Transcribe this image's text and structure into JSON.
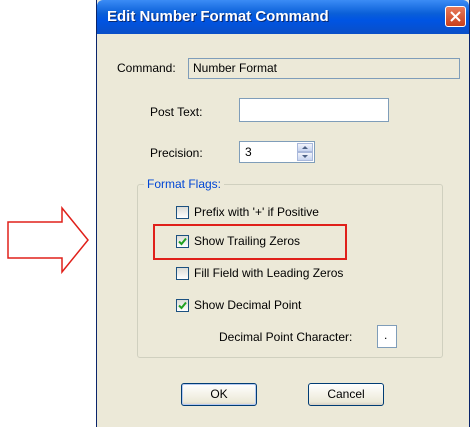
{
  "window": {
    "title": "Edit Number Format Command"
  },
  "command": {
    "label": "Command:",
    "value": "Number Format"
  },
  "post_text": {
    "label": "Post Text:",
    "value": ""
  },
  "precision": {
    "label": "Precision:",
    "value": "3"
  },
  "format_flags": {
    "title": "Format Flags:",
    "options": [
      {
        "label": "Prefix with '+' if Positive",
        "checked": false
      },
      {
        "label": "Show Trailing Zeros",
        "checked": true
      },
      {
        "label": "Fill Field with Leading Zeros",
        "checked": false
      },
      {
        "label": "Show Decimal Point",
        "checked": true
      }
    ],
    "decimal_char_label": "Decimal Point Character:",
    "decimal_char_value": "."
  },
  "buttons": {
    "ok": "OK",
    "cancel": "Cancel"
  },
  "colors": {
    "title_bar": "#0054e3",
    "highlight": "#e0201a",
    "group_title": "#0046d5"
  }
}
